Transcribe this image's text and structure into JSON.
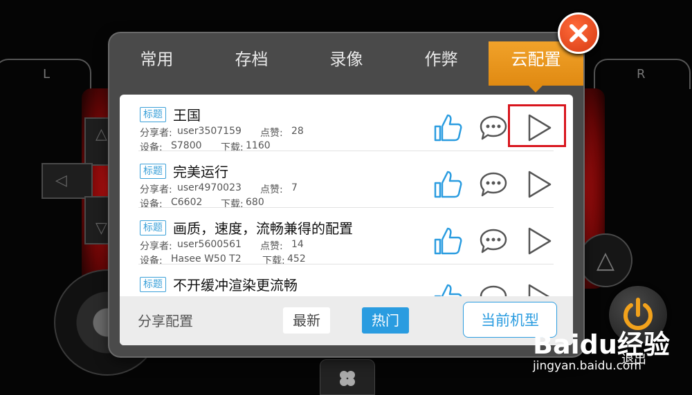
{
  "background": {
    "shoulder_left": "L",
    "shoulder_right": "R",
    "exit_label": "退出",
    "accent_red": "#b01010"
  },
  "dialog": {
    "tabs": [
      {
        "label": "常用",
        "active": false
      },
      {
        "label": "存档",
        "active": false
      },
      {
        "label": "录像",
        "active": false
      },
      {
        "label": "作弊",
        "active": false
      },
      {
        "label": "云配置",
        "active": true
      }
    ],
    "accent_orange": "#e8951a",
    "close_icon": "close-x-icon"
  },
  "list": {
    "tag_label": "标题",
    "sharer_label": "分享者:",
    "likes_label": "点赞:",
    "device_label": "设备:",
    "downloads_label": "下载:",
    "items": [
      {
        "title": "王国",
        "sharer": "user3507159",
        "likes": "28",
        "device": "S7800",
        "downloads": "1160"
      },
      {
        "title": "完美运行",
        "sharer": "user4970023",
        "likes": "7",
        "device": "C6602",
        "downloads": "680"
      },
      {
        "title": "画质，速度，流畅兼得的配置",
        "sharer": "user5600561",
        "likes": "14",
        "device": "Hasee W50 T2",
        "downloads": "452"
      },
      {
        "title": "不开缓冲渲染更流畅",
        "sharer": "",
        "likes": "",
        "device": "",
        "downloads": ""
      }
    ],
    "icons": [
      "thumbs-up-icon",
      "comment-icon",
      "play-icon"
    ],
    "icon_color": "#2a9ce0"
  },
  "bottom_bar": {
    "share_label": "分享配置",
    "newest_label": "最新",
    "hot_label": "热门",
    "current_model_label": "当前机型",
    "hot_color": "#2a9ce0"
  },
  "watermark": {
    "logo": "Baidu经验",
    "url": "jingyan.baidu.com"
  }
}
